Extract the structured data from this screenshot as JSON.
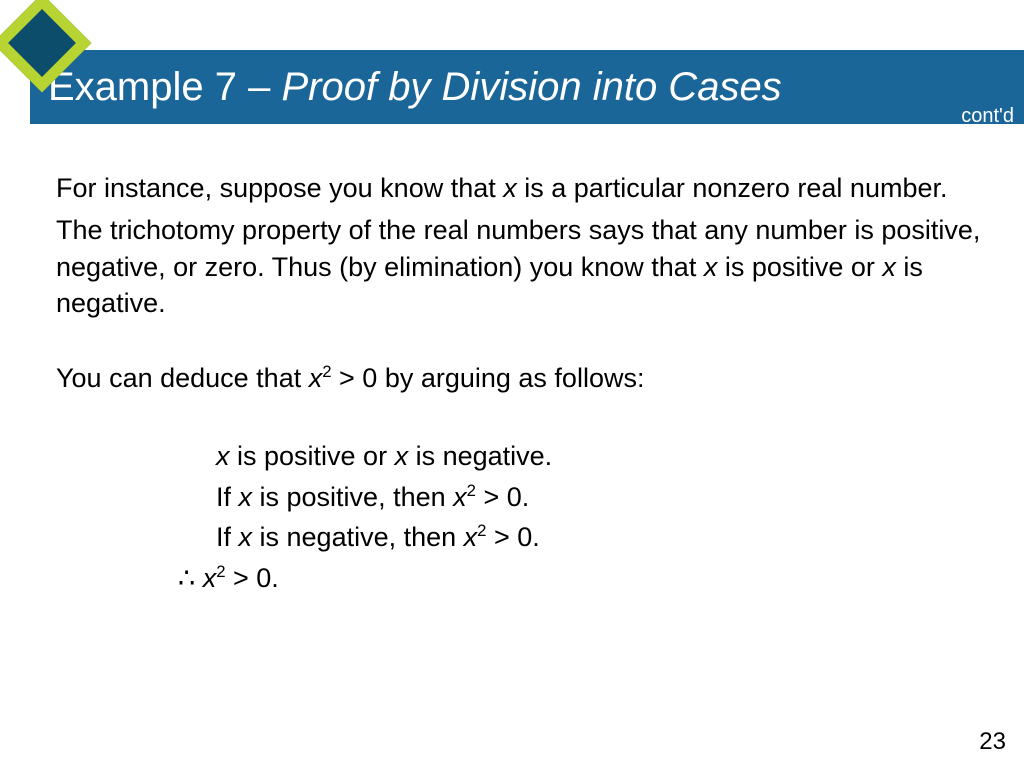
{
  "header": {
    "title_plain": "Example 7 – ",
    "title_italic": "Proof by Division into Cases",
    "contd": "cont'd"
  },
  "body": {
    "p1_a": "For instance, suppose you know that ",
    "p1_b": " is a particular nonzero real number.",
    "p2_a": "The trichotomy property of the real numbers says that any number is positive, negative, or zero. Thus (by elimination) you know that ",
    "p2_b": " is positive or ",
    "p2_c": " is negative.",
    "p3_a": "You can deduce that ",
    "p3_b": " > 0 by arguing as follows:",
    "l1_a": " is positive or ",
    "l1_b": " is negative.",
    "l2_a": "If ",
    "l2_b": " is positive, then ",
    "l2_c": " > 0.",
    "l3_a": "If ",
    "l3_b": " is negative, then ",
    "l3_c": " > 0.",
    "l4_a": " > 0."
  },
  "sym": {
    "x": "x",
    "sq": "2",
    "therefore": "∴"
  },
  "page": "23"
}
